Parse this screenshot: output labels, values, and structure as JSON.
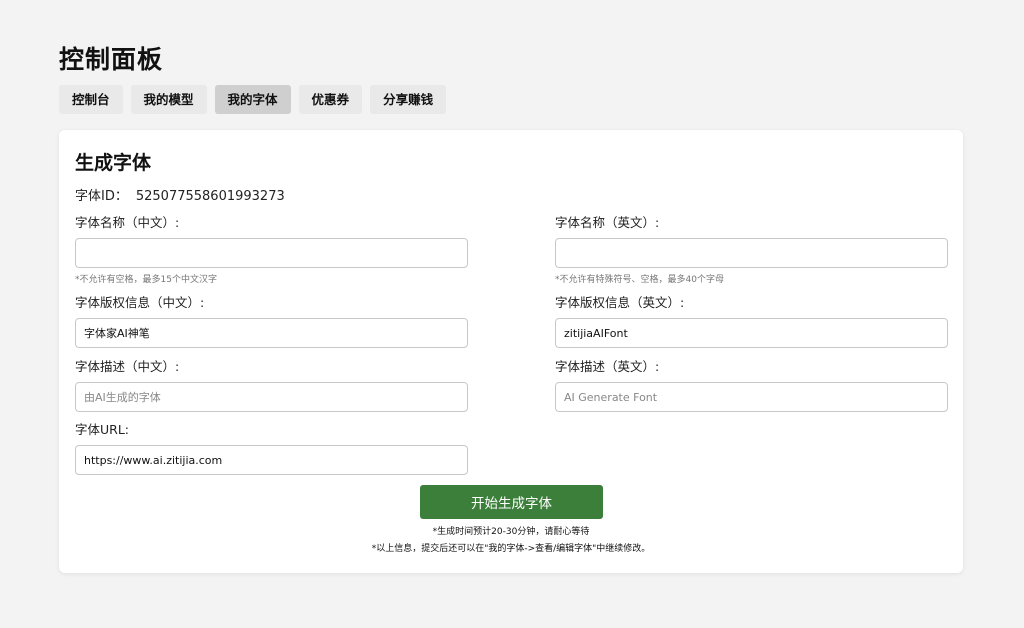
{
  "page": {
    "title": "控制面板"
  },
  "tabs": [
    {
      "label": "控制台"
    },
    {
      "label": "我的模型"
    },
    {
      "label": "我的字体",
      "active": true
    },
    {
      "label": "优惠券"
    },
    {
      "label": "分享赚钱"
    }
  ],
  "form": {
    "title": "生成字体",
    "font_id_label": "字体ID：",
    "font_id_value": "525077558601993273",
    "name_cn": {
      "label": "字体名称（中文）:",
      "value": "",
      "placeholder": "",
      "hint": "*不允许有空格，最多15个中文汉字"
    },
    "name_en": {
      "label": "字体名称（英文）:",
      "value": "",
      "placeholder": "",
      "hint": "*不允许有特殊符号、空格，最多40个字母"
    },
    "copyright_cn": {
      "label": "字体版权信息（中文）:",
      "value": "字体家AI神笔"
    },
    "copyright_en": {
      "label": "字体版权信息（英文）:",
      "value": "zitijiaAIFont"
    },
    "desc_cn": {
      "label": "字体描述（中文）:",
      "value": "",
      "placeholder": "由AI生成的字体"
    },
    "desc_en": {
      "label": "字体描述（英文）:",
      "value": "",
      "placeholder": "AI Generate Font"
    },
    "url": {
      "label": "字体URL:",
      "value": "https://www.ai.zitijia.com"
    },
    "submit_label": "开始生成字体",
    "note_time": "*生成时间预计20-30分钟，请耐心等待",
    "note_edit": "*以上信息，提交后还可以在\"我的字体->查看/编辑字体\"中继续修改。"
  },
  "colors": {
    "primary_button": "#3b7f3b",
    "active_tab": "#cfcfcf",
    "tab": "#e9e9e9"
  }
}
